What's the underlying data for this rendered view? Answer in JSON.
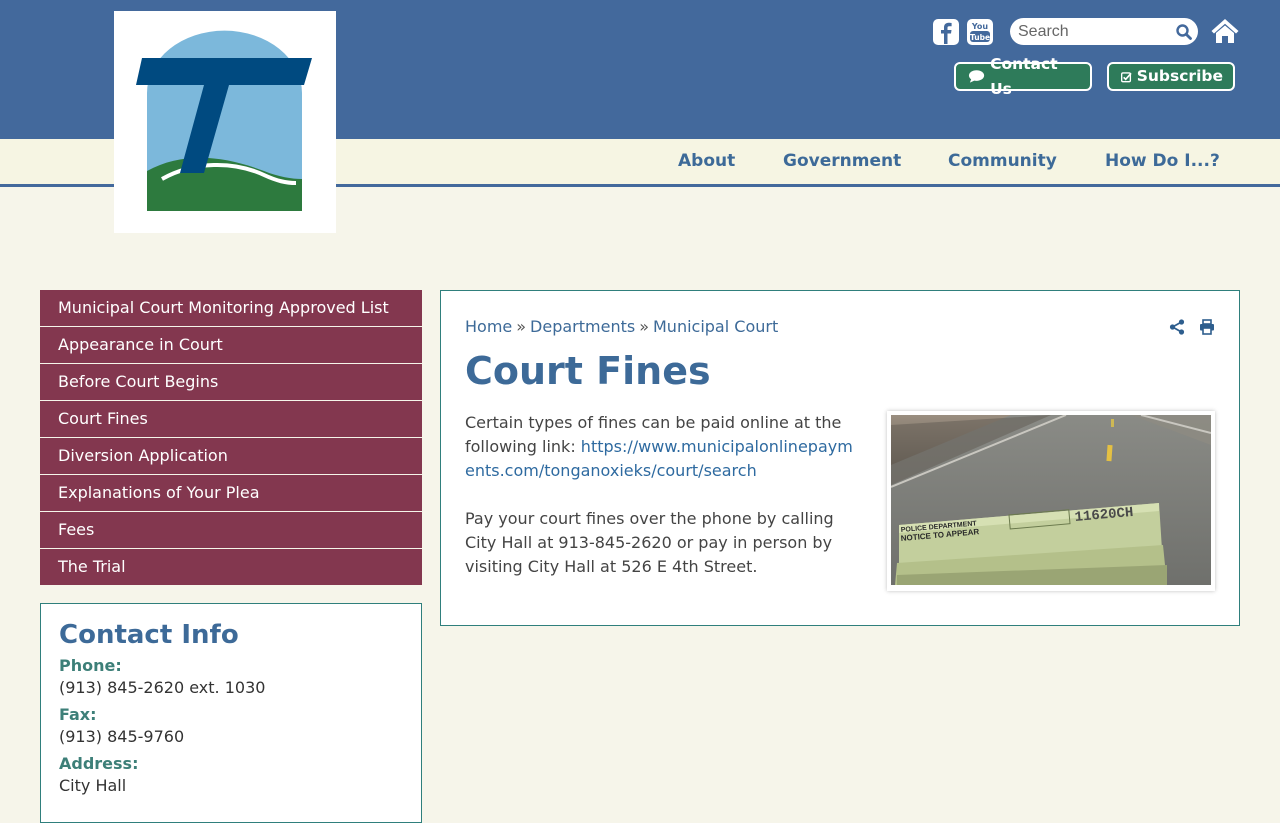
{
  "header": {
    "social": {
      "facebook_icon": "facebook-icon",
      "youtube_icon": "youtube-icon"
    },
    "search": {
      "placeholder": "Search"
    },
    "contact_button": "Contact Us",
    "subscribe_button": "Subscribe"
  },
  "nav": {
    "items": [
      "About",
      "Government",
      "Community",
      "How Do I...?"
    ]
  },
  "sidebar": {
    "items": [
      "Municipal Court Monitoring Approved List",
      "Appearance in Court",
      "Before Court Begins",
      "Court Fines",
      "Diversion Application",
      "Explanations of Your Plea",
      "Fees",
      "The Trial"
    ]
  },
  "contact": {
    "title": "Contact Info",
    "phone_label": "Phone:",
    "phone": "(913) 845-2620 ext. 1030",
    "fax_label": "Fax:",
    "fax": "(913) 845-9760",
    "address_label": "Address:",
    "address": "City Hall"
  },
  "breadcrumb": {
    "home": "Home",
    "departments": "Departments",
    "current": "Municipal Court",
    "separator": "»"
  },
  "page": {
    "title": "Court Fines",
    "para1_a": "Certain types of fines can be paid online at the following link:",
    "link": "https://www.municipalonlinepayments.com/tonganoxieks/court/search",
    "para2": "Pay your court fines over the phone by calling City Hall at 913-845-2620 or pay in person by visiting City Hall at 526 E 4th Street."
  },
  "photo": {
    "ticket_header": "POLICE DEPARTMENT",
    "ticket_title": "NOTICE TO APPEAR",
    "ticket_number": "11620CH"
  },
  "colors": {
    "header_blue": "#43699c",
    "sidebar_maroon": "#83374f",
    "button_green": "#2e7b5a",
    "title_blue": "#3d6a98",
    "page_bg": "#f6f5ea"
  }
}
